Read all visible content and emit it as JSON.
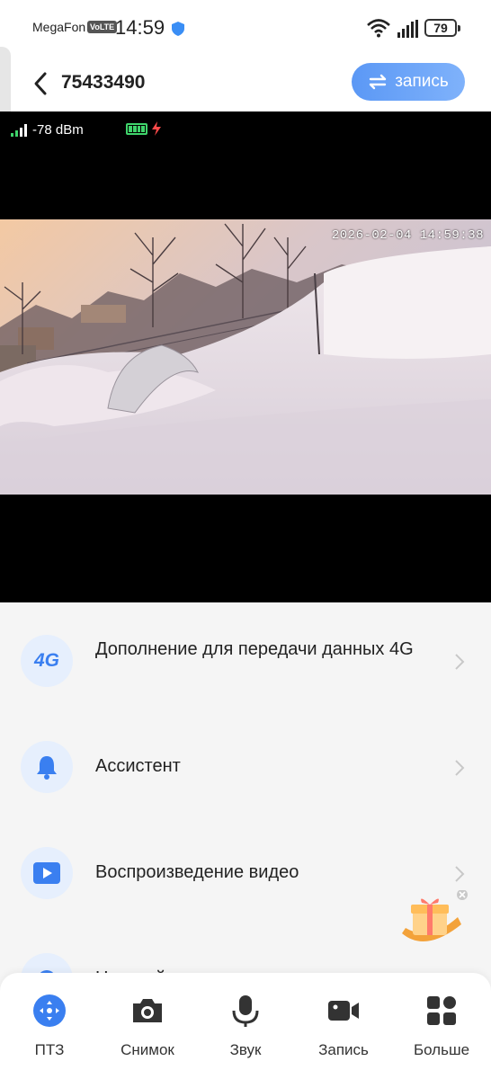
{
  "status_bar": {
    "carrier": "MegaFon",
    "volte": "VoLTE",
    "time": "14:59",
    "battery": "79"
  },
  "header": {
    "title": "75433490",
    "record_button": "запись"
  },
  "video": {
    "signal": "-78 dBm",
    "timestamp": "2026-02-04 14:59:38"
  },
  "menu": {
    "items": [
      {
        "icon": "4g-icon",
        "icon_text": "4G",
        "label": "Дополнение для передачи данных 4G"
      },
      {
        "icon": "bell-icon",
        "label": "Ассистент"
      },
      {
        "icon": "play-video-icon",
        "label": "Воспроизведение видео"
      },
      {
        "icon": "settings-icon",
        "label": "Настройки"
      }
    ]
  },
  "toolbar": {
    "items": [
      {
        "icon": "ptz-icon",
        "label": "ПТЗ"
      },
      {
        "icon": "camera-icon",
        "label": "Снимок"
      },
      {
        "icon": "microphone-icon",
        "label": "Звук"
      },
      {
        "icon": "video-record-icon",
        "label": "Запись"
      },
      {
        "icon": "grid-more-icon",
        "label": "Больше"
      }
    ]
  },
  "colors": {
    "accent": "#3a7ff0",
    "icon_bg": "#e6effd",
    "background": "#f5f5f5"
  }
}
